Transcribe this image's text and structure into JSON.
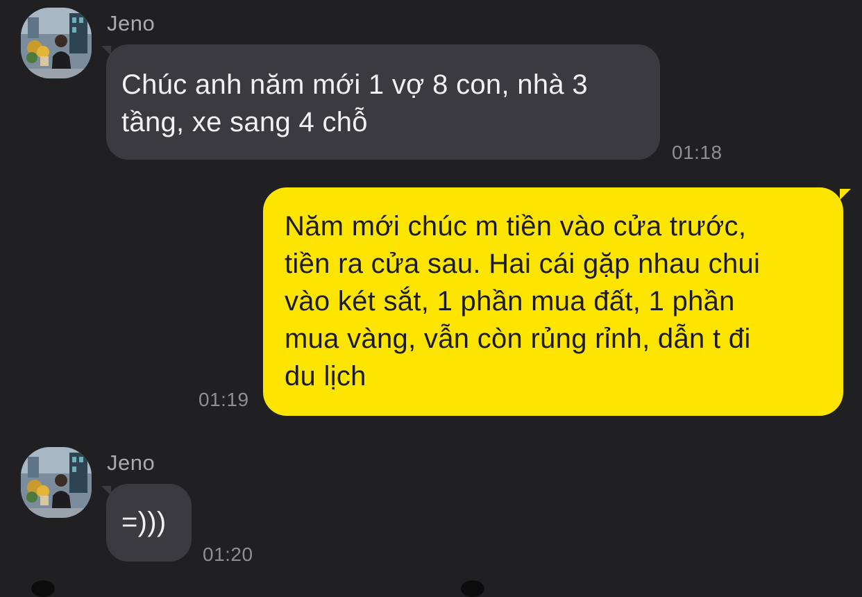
{
  "messages": [
    {
      "sender": "Jeno",
      "direction": "incoming",
      "text_lines": [
        "Chúc anh năm mới 1 vợ 8 con, nhà 3",
        "tầng, xe sang 4 chỗ"
      ],
      "time": "01:18"
    },
    {
      "direction": "outgoing",
      "text_lines": [
        "Năm mới chúc m tiền vào cửa trước,",
        "tiền ra cửa sau. Hai cái gặp nhau chui",
        "vào két sắt, 1 phần mua đất, 1 phần",
        "mua vàng, vẫn còn rủng rỉnh, dẫn t đi",
        "du lịch"
      ],
      "time": "01:19"
    },
    {
      "sender": "Jeno",
      "direction": "incoming",
      "text_lines": [
        "=)))"
      ],
      "time": "01:20"
    }
  ],
  "colors": {
    "background": "#202023",
    "incoming_bubble": "#3b3b3f",
    "outgoing_bubble": "#fee500"
  }
}
